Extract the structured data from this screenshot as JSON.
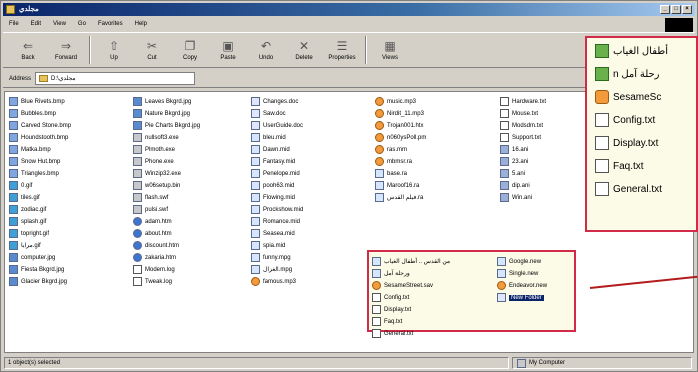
{
  "window": {
    "title": "مجلدي"
  },
  "title_buttons": {
    "minimize": "_",
    "maximize": "□",
    "close": "×"
  },
  "menu": [
    "File",
    "Edit",
    "View",
    "Go",
    "Favorites",
    "Help"
  ],
  "toolbar": [
    {
      "label": "Back",
      "icon": "back-arrow-icon",
      "glyph": "⇐"
    },
    {
      "label": "Forward",
      "icon": "forward-arrow-icon",
      "glyph": "⇒"
    },
    {
      "label": "Up",
      "icon": "up-folder-icon",
      "glyph": "⇧"
    },
    {
      "label": "Cut",
      "icon": "scissors-icon",
      "glyph": "✂"
    },
    {
      "label": "Copy",
      "icon": "copy-icon",
      "glyph": "❐"
    },
    {
      "label": "Paste",
      "icon": "paste-icon",
      "glyph": "▣"
    },
    {
      "label": "Undo",
      "icon": "undo-icon",
      "glyph": "↶"
    },
    {
      "label": "Delete",
      "icon": "delete-icon",
      "glyph": "✕"
    },
    {
      "label": "Properties",
      "icon": "properties-icon",
      "glyph": "☰"
    },
    {
      "label": "Views",
      "icon": "views-icon",
      "glyph": "▦"
    }
  ],
  "address": {
    "label": "Address",
    "value": "D:\\مجلدي"
  },
  "columns": [
    [
      {
        "name": "Blue Rivets.bmp",
        "type": "bmp"
      },
      {
        "name": "Bubbles.bmp",
        "type": "bmp"
      },
      {
        "name": "Carved Stone.bmp",
        "type": "bmp"
      },
      {
        "name": "Houndstooth.bmp",
        "type": "bmp"
      },
      {
        "name": "Matka.bmp",
        "type": "bmp"
      },
      {
        "name": "Snow Hut.bmp",
        "type": "bmp"
      },
      {
        "name": "Triangles.bmp",
        "type": "bmp"
      },
      {
        "name": "0.gif",
        "type": "gif"
      },
      {
        "name": "tiles.gif",
        "type": "gif"
      },
      {
        "name": "zodiac.gif",
        "type": "gif"
      },
      {
        "name": "splash.gif",
        "type": "gif"
      },
      {
        "name": "topright.gif",
        "type": "gif"
      },
      {
        "name": "مرايا.gif",
        "type": "gif"
      },
      {
        "name": "computer.jpg",
        "type": "jpg"
      },
      {
        "name": "Fiesta Bkgrd.jpg",
        "type": "jpg"
      },
      {
        "name": "Glacier Bkgrd.jpg",
        "type": "jpg"
      }
    ],
    [
      {
        "name": "Leaves Bkgrd.jpg",
        "type": "jpg"
      },
      {
        "name": "Nature Bkgrd.jpg",
        "type": "jpg"
      },
      {
        "name": "Pie Charts Bkgrd.jpg",
        "type": "jpg"
      },
      {
        "name": "nullsoft3.exe",
        "type": "exe"
      },
      {
        "name": "Plmoth.exe",
        "type": "exe"
      },
      {
        "name": "Phone.exe",
        "type": "exe"
      },
      {
        "name": "Winzip32.exe",
        "type": "exe"
      },
      {
        "name": "w06setup.bin",
        "type": "exe"
      },
      {
        "name": "flash.swf",
        "type": "exe"
      },
      {
        "name": "pulsi.swf",
        "type": "exe"
      },
      {
        "name": "adam.htm",
        "type": "htm"
      },
      {
        "name": "about.htm",
        "type": "htm"
      },
      {
        "name": "discount.htm",
        "type": "htm"
      },
      {
        "name": "zakaria.htm",
        "type": "htm"
      },
      {
        "name": "Modem.log",
        "type": "txt"
      },
      {
        "name": "Tweak.log",
        "type": "txt"
      }
    ],
    [
      {
        "name": "Changes.doc",
        "type": "doc"
      },
      {
        "name": "Saw.doc",
        "type": "doc"
      },
      {
        "name": "UserGuide.doc",
        "type": "doc"
      },
      {
        "name": "bleu.mid",
        "type": "mid"
      },
      {
        "name": "Dawn.mid",
        "type": "mid"
      },
      {
        "name": "Fantasy.mid",
        "type": "mid"
      },
      {
        "name": "Penelope.mid",
        "type": "mid"
      },
      {
        "name": "pooh63.mid",
        "type": "mid"
      },
      {
        "name": "Flowing.mid",
        "type": "mid"
      },
      {
        "name": "Prockshow.mid",
        "type": "mid"
      },
      {
        "name": "Romance.mid",
        "type": "mid"
      },
      {
        "name": "Seasea.mid",
        "type": "mid"
      },
      {
        "name": "spia.mid",
        "type": "mid"
      },
      {
        "name": "funny.mpg",
        "type": "mid"
      },
      {
        "name": "الغزال.mpg",
        "type": "mid"
      },
      {
        "name": "famous.mp3",
        "type": "mp3"
      }
    ],
    [
      {
        "name": "music.mp3",
        "type": "mp3"
      },
      {
        "name": "Nirdit_11.mp3",
        "type": "mp3"
      },
      {
        "name": "Trojan001.htx",
        "type": "mp3"
      },
      {
        "name": "n060ysPoll.pm",
        "type": "mp3"
      },
      {
        "name": "ras.mm",
        "type": "mp3"
      },
      {
        "name": "mbmsr.ra",
        "type": "mp3"
      },
      {
        "name": "base.ra",
        "type": "mid"
      },
      {
        "name": "Maroof16.ra",
        "type": "mid"
      },
      {
        "name": "فيلم القدس.ra",
        "type": "mid"
      }
    ],
    [
      {
        "name": "Hardware.txt",
        "type": "txt"
      },
      {
        "name": "Mouse.txt",
        "type": "txt"
      },
      {
        "name": "Modsdm.txt",
        "type": "txt"
      },
      {
        "name": "Support.txt",
        "type": "txt"
      },
      {
        "name": "16.ani",
        "type": "ani"
      },
      {
        "name": "23.ani",
        "type": "ani"
      },
      {
        "name": "5.ani",
        "type": "ani"
      },
      {
        "name": "dip.ani",
        "type": "ani"
      },
      {
        "name": "Win.ani",
        "type": "ani"
      }
    ]
  ],
  "highlight": {
    "col1": [
      "من القدس .. أطفال الغياب",
      "ورحلة آمل",
      "SesameStreet.sav",
      "Config.txt",
      "Display.txt",
      "Faq.txt",
      "General.txt"
    ],
    "col2": [
      "Google.new",
      "Single.new",
      "Endeavor.new",
      "New Folder"
    ]
  },
  "zoom": [
    "أطفال الغياب",
    "n رحلة آمل",
    "SesameSc",
    "Config.txt",
    "Display.txt",
    "Faq.txt",
    "General.txt"
  ],
  "status": {
    "selection": "1 object(s) selected",
    "zone": "My Computer"
  },
  "colors": {
    "title_start": "#0a246a",
    "highlight_border": "#d22b4a",
    "arrow": "#b31b1b"
  }
}
